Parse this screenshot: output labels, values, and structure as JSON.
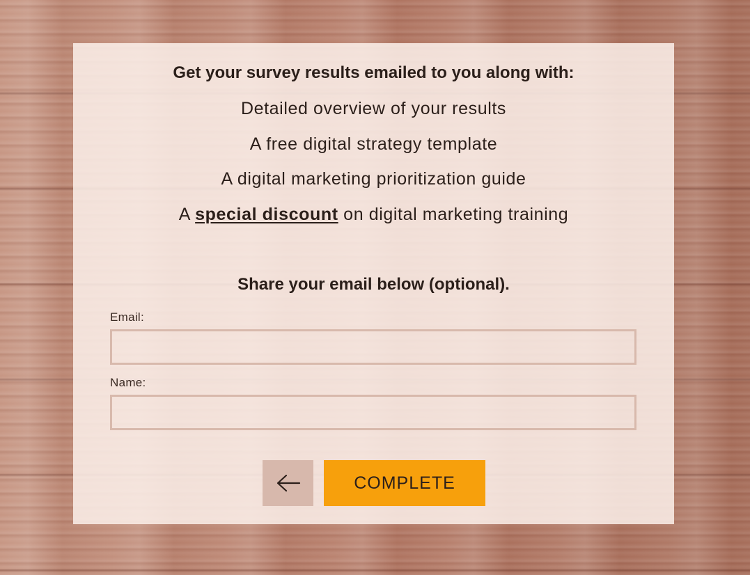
{
  "page": {
    "heading": "Get your survey results emailed to you along with:",
    "benefits": [
      {
        "text": "Detailed overview of your results"
      },
      {
        "text": "A free digital strategy template"
      },
      {
        "text": "A digital marketing prioritization guide"
      },
      {
        "prefix": "A ",
        "emphasis": "special discount",
        "suffix": " on digital marketing training"
      }
    ],
    "share_prompt": "Share your email below (optional).",
    "form": {
      "email_label": "Email:",
      "email_value": "",
      "name_label": "Name:",
      "name_value": ""
    },
    "buttons": {
      "back_icon": "arrow-left-icon",
      "complete_label": "COMPLETE"
    }
  },
  "colors": {
    "card_background": "#fcf0ea",
    "input_border": "#d8b9ac",
    "back_button": "#d7b8ac",
    "complete_button": "#f7a00c",
    "text": "#2b1f1a"
  }
}
